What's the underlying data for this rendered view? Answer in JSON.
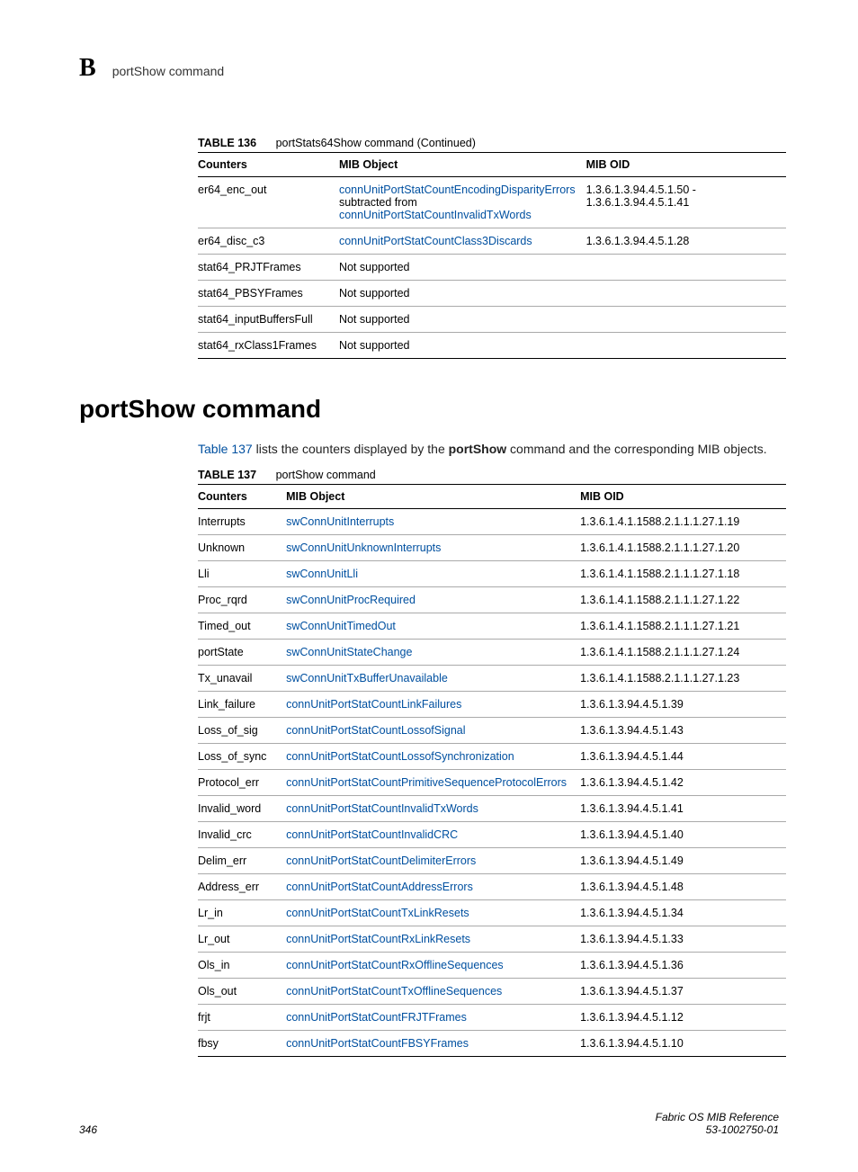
{
  "header": {
    "appendix": "B",
    "title": "portShow command"
  },
  "table136": {
    "caption_label": "TABLE 136",
    "caption_text": "portStats64Show command (Continued)",
    "headers": {
      "col1": "Counters",
      "col2": "MIB Object",
      "col3": "MIB OID"
    },
    "rows": [
      {
        "counter": "er64_enc_out",
        "obj_link1": "connUnitPortStatCountEncodingDisparityErrors",
        "obj_mid": " subtracted from ",
        "obj_link2": "connUnitPortStatCountInvalidTxWords",
        "oid": "1.3.6.1.3.94.4.5.1.50 - 1.3.6.1.3.94.4.5.1.41"
      },
      {
        "counter": "er64_disc_c3",
        "obj_link1": "connUnitPortStatCountClass3Discards",
        "oid": "1.3.6.1.3.94.4.5.1.28"
      },
      {
        "counter": "stat64_PRJTFrames",
        "obj_plain": "Not supported",
        "oid": ""
      },
      {
        "counter": "stat64_PBSYFrames",
        "obj_plain": "Not supported",
        "oid": ""
      },
      {
        "counter": "stat64_inputBuffersFull",
        "obj_plain": "Not supported",
        "oid": ""
      },
      {
        "counter": "stat64_rxClass1Frames",
        "obj_plain": "Not supported",
        "oid": ""
      }
    ]
  },
  "section": {
    "heading": "portShow command",
    "intro_prefix": "Table 137",
    "intro_mid": " lists the counters displayed by the ",
    "intro_cmd": "portShow",
    "intro_suffix": " command and the corresponding MIB objects."
  },
  "table137": {
    "caption_label": "TABLE 137",
    "caption_text": "portShow command",
    "headers": {
      "col1": "Counters",
      "col2": "MIB Object",
      "col3": "MIB OID"
    },
    "rows": [
      {
        "counter": "Interrupts",
        "obj": "swConnUnitInterrupts",
        "oid": "1.3.6.1.4.1.1588.2.1.1.1.27.1.19"
      },
      {
        "counter": "Unknown",
        "obj": "swConnUnitUnknownInterrupts",
        "oid": "1.3.6.1.4.1.1588.2.1.1.1.27.1.20"
      },
      {
        "counter": "Lli",
        "obj": "swConnUnitLli",
        "oid": "1.3.6.1.4.1.1588.2.1.1.1.27.1.18"
      },
      {
        "counter": "Proc_rqrd",
        "obj": "swConnUnitProcRequired",
        "oid": "1.3.6.1.4.1.1588.2.1.1.1.27.1.22"
      },
      {
        "counter": "Timed_out",
        "obj": "swConnUnitTimedOut",
        "oid": "1.3.6.1.4.1.1588.2.1.1.1.27.1.21"
      },
      {
        "counter": "portState",
        "obj": "swConnUnitStateChange",
        "oid": "1.3.6.1.4.1.1588.2.1.1.1.27.1.24"
      },
      {
        "counter": "Tx_unavail",
        "obj": "swConnUnitTxBufferUnavailable",
        "oid": "1.3.6.1.4.1.1588.2.1.1.1.27.1.23"
      },
      {
        "counter": "Link_failure",
        "obj": "connUnitPortStatCountLinkFailures",
        "oid": "1.3.6.1.3.94.4.5.1.39"
      },
      {
        "counter": "Loss_of_sig",
        "obj": "connUnitPortStatCountLossofSignal",
        "oid": "1.3.6.1.3.94.4.5.1.43"
      },
      {
        "counter": "Loss_of_sync",
        "obj": "connUnitPortStatCountLossofSynchronization",
        "oid": "1.3.6.1.3.94.4.5.1.44"
      },
      {
        "counter": "Protocol_err",
        "obj": "connUnitPortStatCountPrimitiveSequenceProtocolErrors",
        "oid": "1.3.6.1.3.94.4.5.1.42"
      },
      {
        "counter": "Invalid_word",
        "obj": "connUnitPortStatCountInvalidTxWords",
        "oid": "1.3.6.1.3.94.4.5.1.41"
      },
      {
        "counter": "Invalid_crc",
        "obj": "connUnitPortStatCountInvalidCRC",
        "oid": "1.3.6.1.3.94.4.5.1.40"
      },
      {
        "counter": "Delim_err",
        "obj": "connUnitPortStatCountDelimiterErrors",
        "oid": "1.3.6.1.3.94.4.5.1.49"
      },
      {
        "counter": "Address_err",
        "obj": "connUnitPortStatCountAddressErrors",
        "oid": "1.3.6.1.3.94.4.5.1.48"
      },
      {
        "counter": "Lr_in",
        "obj": "connUnitPortStatCountTxLinkResets",
        "oid": "1.3.6.1.3.94.4.5.1.34"
      },
      {
        "counter": "Lr_out",
        "obj": "connUnitPortStatCountRxLinkResets",
        "oid": "1.3.6.1.3.94.4.5.1.33"
      },
      {
        "counter": "Ols_in",
        "obj": "connUnitPortStatCountRxOfflineSequences",
        "oid": "1.3.6.1.3.94.4.5.1.36"
      },
      {
        "counter": "Ols_out",
        "obj": "connUnitPortStatCountTxOfflineSequences",
        "oid": "1.3.6.1.3.94.4.5.1.37"
      },
      {
        "counter": "frjt",
        "obj": "connUnitPortStatCountFRJTFrames",
        "oid": "1.3.6.1.3.94.4.5.1.12"
      },
      {
        "counter": "fbsy",
        "obj": "connUnitPortStatCountFBSYFrames",
        "oid": "1.3.6.1.3.94.4.5.1.10"
      }
    ]
  },
  "footer": {
    "page": "346",
    "doc": "Fabric OS MIB Reference",
    "docnum": "53-1002750-01"
  }
}
